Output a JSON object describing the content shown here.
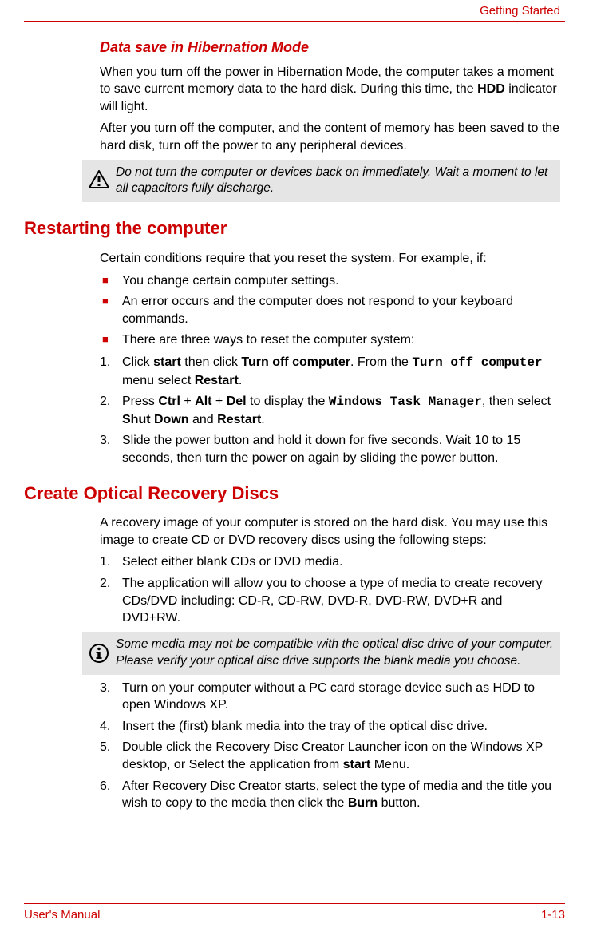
{
  "header": {
    "section": "Getting Started"
  },
  "section1": {
    "title": "Data save in Hibernation Mode",
    "p1_a": "When you turn off the power in Hibernation Mode, the computer takes a moment to save current memory data to the hard disk. During this time, the ",
    "p1_b": "HDD",
    "p1_c": " indicator will light.",
    "p2": "After you turn off the computer, and the content of memory has been saved to the hard disk, turn off the power to any peripheral devices.",
    "callout": "Do not turn the computer or devices back on immediately. Wait a moment to let all capacitors fully discharge."
  },
  "section2": {
    "title": "Restarting the computer",
    "intro": "Certain conditions require that you reset the system. For example, if:",
    "bullets": {
      "b1": "You change certain computer settings.",
      "b2": "An error occurs and the computer does not respond to your keyboard commands.",
      "b3": "There are three ways to reset the computer system:"
    },
    "steps": {
      "s1": {
        "num": "1.",
        "a": "Click ",
        "b": "start",
        "c": " then click ",
        "d": "Turn off computer",
        "e": ". From the ",
        "f": "Turn off computer",
        "g": " menu select ",
        "h": "Restart",
        "i": "."
      },
      "s2": {
        "num": "2.",
        "a": "Press ",
        "b": "Ctrl",
        "c": " + ",
        "d": "Alt",
        "e": " + ",
        "f": "Del",
        "g": " to display the ",
        "h": "Windows Task Manager",
        "i": ", then select ",
        "j": "Shut Down",
        "k": " and ",
        "l": "Restart",
        "m": "."
      },
      "s3": {
        "num": "3.",
        "text": "Slide the power button and hold it down for five seconds. Wait 10 to 15 seconds, then turn the power on again by sliding the power button."
      }
    }
  },
  "section3": {
    "title": "Create Optical Recovery Discs",
    "intro": "A recovery image of your computer is stored on the hard disk. You may use this image to create CD or DVD recovery discs using the following steps:",
    "s1": {
      "num": "1.",
      "text": "Select either blank CDs or DVD media."
    },
    "s2": {
      "num": "2.",
      "text": "The application will allow you to choose a type of media to create recovery CDs/DVD including: CD-R, CD-RW, DVD-R, DVD-RW, DVD+R and DVD+RW."
    },
    "callout": "Some media may not be compatible with the optical disc drive of your computer. Please verify your optical disc drive supports the blank media you choose.",
    "s3": {
      "num": "3.",
      "text": "Turn on your computer without a PC card storage device such as HDD to open Windows XP."
    },
    "s4": {
      "num": "4.",
      "text": "Insert the (first) blank media into the tray of the optical disc drive."
    },
    "s5": {
      "num": "5.",
      "a": "Double click the Recovery Disc Creator Launcher icon on the Windows XP desktop, or Select the application from ",
      "b": "start",
      "c": " Menu."
    },
    "s6": {
      "num": "6.",
      "a": "After Recovery Disc Creator starts, select the type of media and the title you wish to copy to the media then click the ",
      "b": "Burn",
      "c": " button."
    }
  },
  "footer": {
    "left": "User's Manual",
    "right": "1-13"
  }
}
